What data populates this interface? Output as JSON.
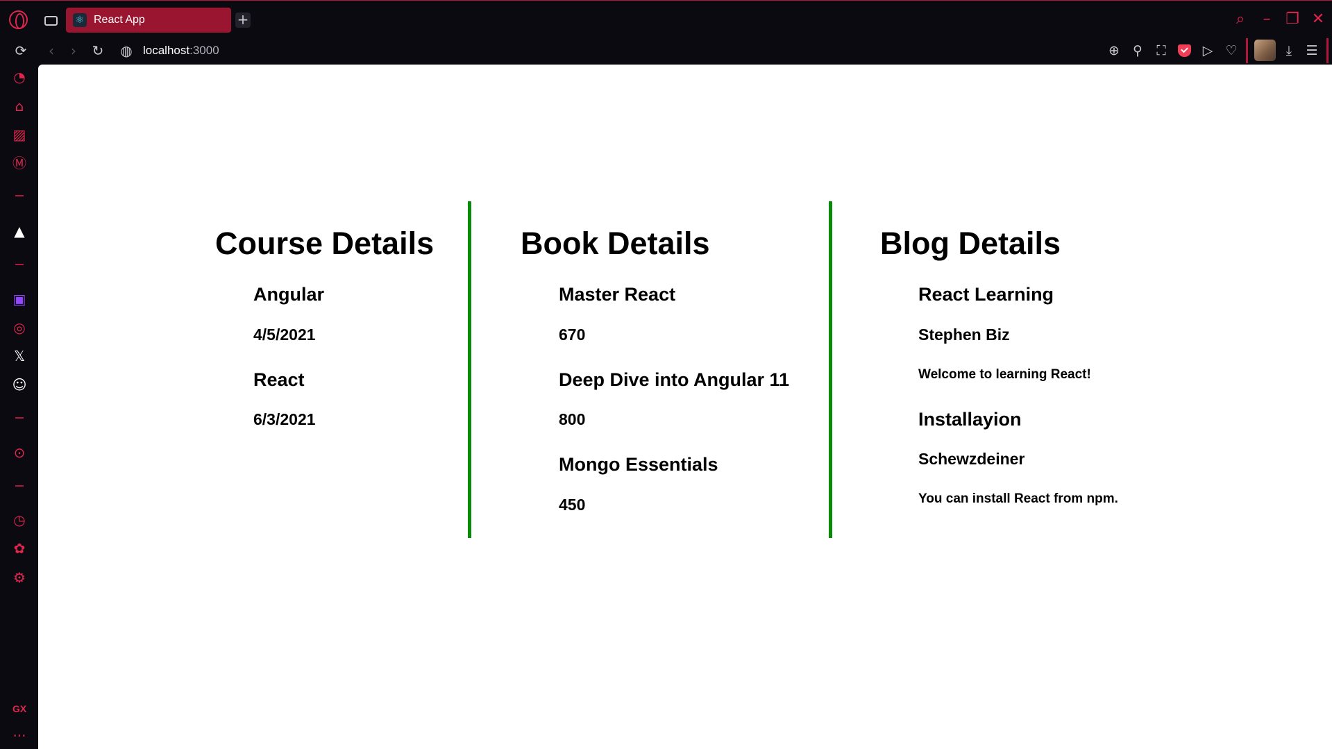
{
  "browser": {
    "tab_title": "React App",
    "new_tab_symbol": "+",
    "url_host": "localhost",
    "url_port": ":3000",
    "sidebar_badge": "GX",
    "more_symbol": "···"
  },
  "courses": {
    "heading": "Course Details",
    "items": [
      {
        "name": "Angular",
        "date": "4/5/2021"
      },
      {
        "name": "React",
        "date": "6/3/2021"
      }
    ]
  },
  "books": {
    "heading": "Book Details",
    "items": [
      {
        "name": "Master React",
        "price": "670"
      },
      {
        "name": "Deep Dive into Angular 11",
        "price": "800"
      },
      {
        "name": "Mongo Essentials",
        "price": "450"
      }
    ]
  },
  "blogs": {
    "heading": "Blog Details",
    "items": [
      {
        "title": "React Learning",
        "author": "Stephen Biz",
        "content": "Welcome to learning React!"
      },
      {
        "title": "Installayion",
        "author": "Schewzdeiner",
        "content": "You can install React from npm."
      }
    ]
  },
  "colors": {
    "accent": "#e0264f",
    "tab_active": "#9a1530",
    "divider": "#0a8a0a",
    "chrome_bg": "#0b0a10"
  }
}
